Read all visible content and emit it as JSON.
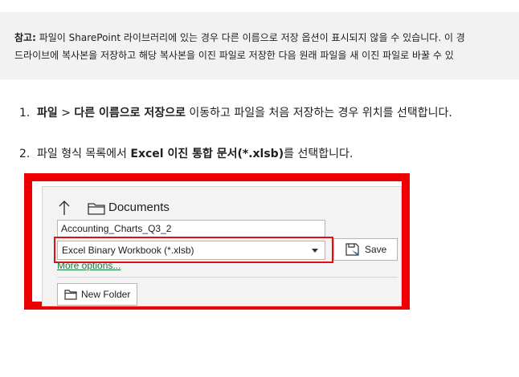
{
  "note": {
    "label": "참고:",
    "line1": "파일이 SharePoint 라이브러리에 있는 경우 다른 이름으로 저장 옵션이 표시되지 않을 수 있습니다. 이 경",
    "line2": "드라이브에 복사본을 저장하고 해당 복사본을 이진 파일로 저장한 다음 원래 파일을 새 이진 파일로 바꿀 수 있"
  },
  "steps": [
    {
      "num": "1.",
      "bold1": "파일",
      "sep": " > ",
      "bold2": "다른 이름으로 저장으로",
      "rest": " 이동하고 파일을 처음 저장하는 경우 위치를 선택합니다."
    },
    {
      "num": "2.",
      "pre": "파일 형식 목록에서 ",
      "bold": "Excel 이진 통합 문서(*.xlsb)",
      "post": "를 선택합니다."
    }
  ],
  "dialog": {
    "location": "Documents",
    "filename": "Accounting_Charts_Q3_2",
    "filetype": "Excel Binary Workbook (*.xlsb)",
    "save_label": "Save",
    "more_options": "More options...",
    "new_folder": "New Folder"
  },
  "colors": {
    "highlight": "#ee0000",
    "link": "#1a7b3e",
    "note_bg": "#f2f2f2"
  },
  "icons": [
    "up-arrow-icon",
    "folder-icon",
    "chevron-down-icon",
    "save-icon",
    "new-folder-icon"
  ]
}
